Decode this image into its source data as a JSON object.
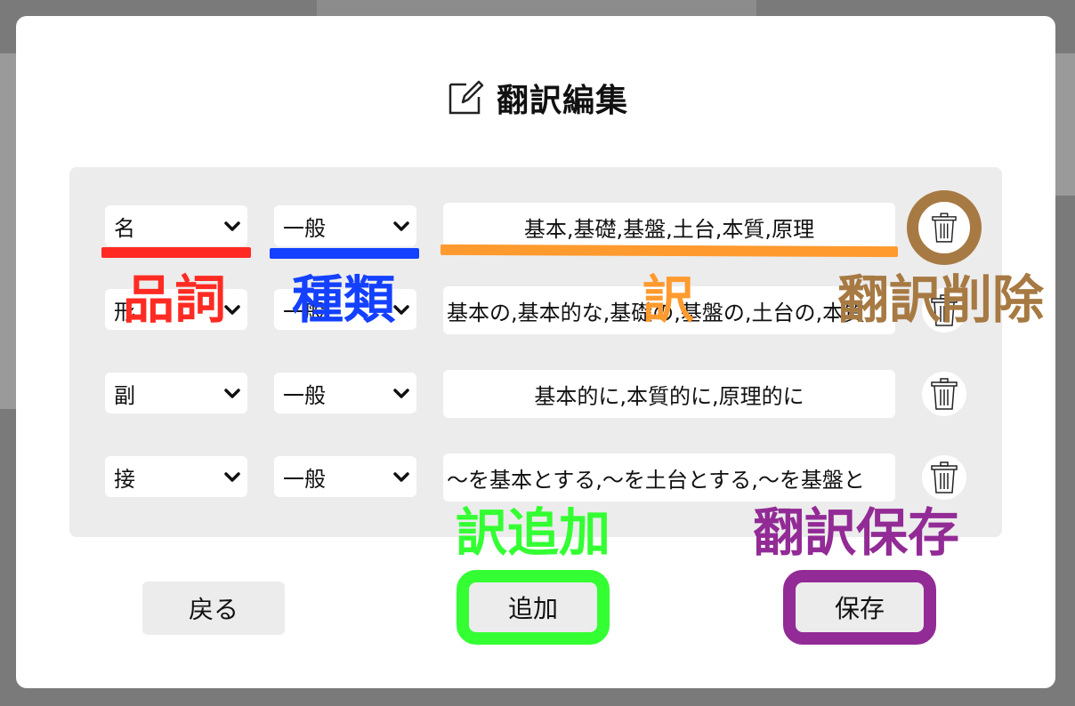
{
  "dialog": {
    "title": "翻訳編集",
    "title_icon": "edit-icon"
  },
  "rows": [
    {
      "pos": "名",
      "kind": "一般",
      "translation": "基本,基礎,基盤,土台,本質,原理"
    },
    {
      "pos": "形",
      "kind": "一般",
      "translation": "基本の,基本的な,基礎の,基盤の,土台の,本質"
    },
    {
      "pos": "副",
      "kind": "一般",
      "translation": "基本的に,本質的に,原理的に"
    },
    {
      "pos": "接",
      "kind": "一般",
      "translation": "〜を基本とする,〜を土台とする,〜を基盤と"
    }
  ],
  "buttons": {
    "back": "戻る",
    "add": "追加",
    "save": "保存"
  },
  "annotations": {
    "pos": "品詞",
    "kind": "種類",
    "translation": "訳",
    "delete": "翻訳削除",
    "add": "訳追加",
    "save": "翻訳保存"
  },
  "colors": {
    "pos": "#ff2b23",
    "kind": "#1440ff",
    "translation": "#ff9a2e",
    "delete": "#a77a43",
    "add": "#33ff33",
    "save": "#922b96"
  }
}
